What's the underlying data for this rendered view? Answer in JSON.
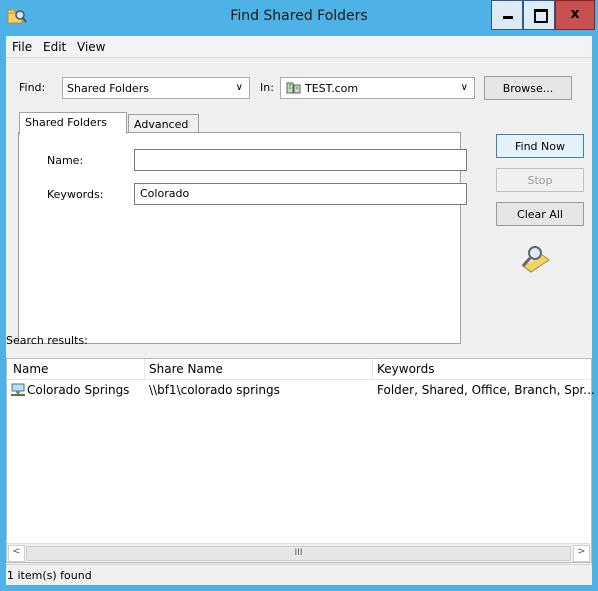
{
  "window": {
    "title": "Find Shared Folders"
  },
  "menu": {
    "file": "File",
    "edit": "Edit",
    "view": "View"
  },
  "find": {
    "find_label": "Find:",
    "find_value": "Shared Folders",
    "in_label": "In:",
    "in_value": "TEST.com",
    "browse_label": "Browse..."
  },
  "tabs": {
    "shared_folders": "Shared Folders",
    "advanced": "Advanced"
  },
  "form": {
    "name_label": "Name:",
    "name_value": "",
    "keywords_label": "Keywords:",
    "keywords_value": "Colorado"
  },
  "actions": {
    "find_now": "Find Now",
    "stop": "Stop",
    "clear_all": "Clear All"
  },
  "results": {
    "label": "Search results:",
    "columns": [
      "Name",
      "Share Name",
      "Keywords"
    ],
    "rows": [
      {
        "name": "Colorado Springs",
        "share": "\\\\bf1\\colorado springs",
        "keywords": "Folder, Shared, Office, Branch, Spr..."
      }
    ],
    "scroll_thumb_glyph": "III"
  },
  "status": {
    "text": "1 item(s) found"
  },
  "icons": {
    "title": "find-folder-icon",
    "domain": "domain-icon",
    "search": "magnifier-search-icon",
    "share": "network-share-icon"
  }
}
